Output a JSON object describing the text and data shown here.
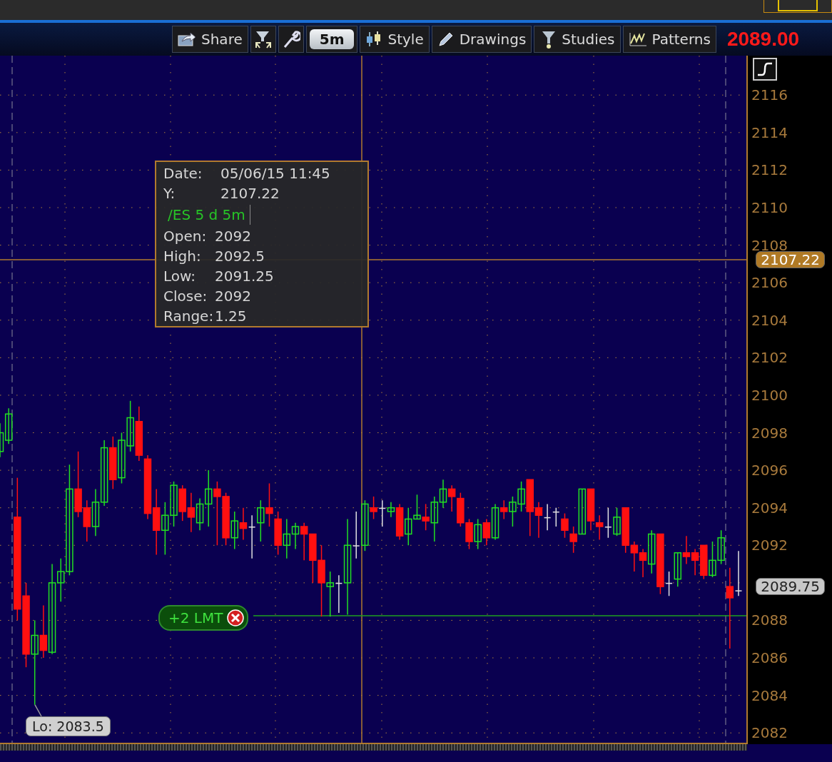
{
  "toolbar": {
    "buttons": [
      {
        "kind": "text",
        "label": "Share"
      },
      {
        "kind": "icon"
      },
      {
        "kind": "icon"
      },
      {
        "kind": "interval",
        "label": "5m",
        "selected": true
      },
      {
        "kind": "text",
        "label": "Style"
      },
      {
        "kind": "text",
        "label": "Drawings"
      },
      {
        "kind": "text",
        "label": "Studies"
      },
      {
        "kind": "text",
        "label": "Patterns"
      }
    ],
    "last_price": "2089.00"
  },
  "chart": {
    "chart_data": {
      "type": "candlestick",
      "ylim": [
        2081.4,
        2118.1
      ],
      "grid": true,
      "ref_lines": [
        {
          "axis": "y",
          "value": 2107.22
        },
        {
          "axis": "y",
          "value": 2088.25
        }
      ],
      "yticks": [
        2116,
        2114,
        2112,
        2110,
        2108,
        2106,
        2104,
        2102,
        2100,
        2098,
        2096,
        2094,
        2092,
        2088,
        2086,
        2084,
        2082
      ],
      "ohlc": [
        [
          2097,
          2098.5,
          2096.7,
          2098
        ],
        [
          2097.6,
          2099.3,
          2097.4,
          2099
        ],
        [
          2093.5,
          2095.6,
          2088,
          2088.6
        ],
        [
          2089.3,
          2090,
          2085.5,
          2086.2
        ],
        [
          2086.2,
          2088,
          2083.5,
          2087.2
        ],
        [
          2087.2,
          2088.8,
          2086,
          2086.4
        ],
        [
          2086.3,
          2091,
          2086.2,
          2090
        ],
        [
          2090,
          2091.3,
          2089,
          2090.6
        ],
        [
          2090.6,
          2096.3,
          2090.4,
          2095
        ],
        [
          2095,
          2097,
          2093.5,
          2093.8
        ],
        [
          2094,
          2094.4,
          2092.2,
          2093
        ],
        [
          2093,
          2095,
          2092.5,
          2094.3
        ],
        [
          2094.3,
          2097.6,
          2094.1,
          2097.2
        ],
        [
          2097.2,
          2097.8,
          2095,
          2095.5
        ],
        [
          2095.6,
          2098,
          2095.3,
          2097.6
        ],
        [
          2097.3,
          2099.7,
          2097,
          2098.8
        ],
        [
          2098.6,
          2099.4,
          2096.5,
          2096.8
        ],
        [
          2096.6,
          2096.8,
          2093.4,
          2093.7
        ],
        [
          2094,
          2095,
          2091.5,
          2092.8
        ],
        [
          2092.8,
          2094.3,
          2091.5,
          2093.6
        ],
        [
          2093.6,
          2095.4,
          2093,
          2095.2
        ],
        [
          2095,
          2095.2,
          2093.3,
          2093.8
        ],
        [
          2094,
          2094.8,
          2092.7,
          2093.5
        ],
        [
          2093.2,
          2094.5,
          2092.8,
          2094.2
        ],
        [
          2094.2,
          2096,
          2093,
          2095
        ],
        [
          2095,
          2095.4,
          2092,
          2094.6
        ],
        [
          2094.6,
          2094.8,
          2092,
          2092.4
        ],
        [
          2092.4,
          2093.8,
          2091.8,
          2093.3
        ],
        [
          2093.2,
          2094,
          2092.3,
          2092.9
        ],
        [
          2093,
          2093.6,
          2091.3,
          2093
        ],
        [
          2093.2,
          2094.4,
          2092.2,
          2094
        ],
        [
          2094,
          2095.3,
          2093,
          2093.7
        ],
        [
          2093.4,
          2093.8,
          2091.5,
          2092
        ],
        [
          2092,
          2093.4,
          2091.3,
          2092.6
        ],
        [
          2092.6,
          2093.2,
          2091.8,
          2093
        ],
        [
          2093,
          2093.2,
          2091.2,
          2092.6
        ],
        [
          2092.6,
          2092.6,
          2090,
          2091.2
        ],
        [
          2091.2,
          2092,
          2088.2,
          2090
        ],
        [
          2089.8,
          2090.6,
          2088.2,
          2090
        ],
        [
          2090,
          2090.4,
          2088.4,
          2090
        ],
        [
          2090,
          2093.4,
          2088.3,
          2092
        ],
        [
          2092,
          2093.8,
          2091.3,
          2092
        ],
        [
          2092,
          2094.4,
          2091.7,
          2094.2
        ],
        [
          2094,
          2094.6,
          2093.4,
          2093.8
        ],
        [
          2094,
          2094.4,
          2093,
          2094
        ],
        [
          2093.8,
          2094.3,
          2093.5,
          2094
        ],
        [
          2094,
          2094.2,
          2092.3,
          2092.5
        ],
        [
          2092.6,
          2094,
          2092,
          2093.4
        ],
        [
          2093.4,
          2094.7,
          2093.4,
          2093.6
        ],
        [
          2093.5,
          2094.2,
          2092.8,
          2093.3
        ],
        [
          2093.2,
          2094.6,
          2092.2,
          2094.3
        ],
        [
          2094.3,
          2095.5,
          2094,
          2095
        ],
        [
          2095,
          2095.2,
          2093.8,
          2094.6
        ],
        [
          2094.5,
          2094.8,
          2093,
          2093.2
        ],
        [
          2093.2,
          2093.4,
          2091.8,
          2092.2
        ],
        [
          2092.2,
          2093.4,
          2091.8,
          2093.1
        ],
        [
          2093.2,
          2093.4,
          2092,
          2092.4
        ],
        [
          2092.4,
          2094.2,
          2092.3,
          2094
        ],
        [
          2094,
          2094.4,
          2093.4,
          2093.8
        ],
        [
          2093.8,
          2094.6,
          2093,
          2094.3
        ],
        [
          2094.2,
          2095.4,
          2093.8,
          2095
        ],
        [
          2095.5,
          2095.5,
          2092.5,
          2093.8
        ],
        [
          2094,
          2094.3,
          2092.4,
          2093.6
        ],
        [
          2093.5,
          2094.2,
          2092.8,
          2093.5
        ],
        [
          2093.8,
          2094,
          2093,
          2093.8
        ],
        [
          2093.4,
          2093.7,
          2092.4,
          2092.8
        ],
        [
          2092.6,
          2093,
          2091.6,
          2092.2
        ],
        [
          2092.6,
          2095,
          2092.6,
          2095
        ],
        [
          2095,
          2095,
          2092.8,
          2093.3
        ],
        [
          2093.2,
          2093.6,
          2092.3,
          2093
        ],
        [
          2093,
          2094,
          2092.4,
          2093
        ],
        [
          2092.6,
          2094,
          2092.5,
          2093.5
        ],
        [
          2094,
          2094,
          2091.6,
          2092
        ],
        [
          2092,
          2092.2,
          2090.6,
          2091.6
        ],
        [
          2091.6,
          2091.8,
          2090.3,
          2091.2
        ],
        [
          2091,
          2092.8,
          2090.5,
          2092.6
        ],
        [
          2092.6,
          2092.6,
          2089.4,
          2089.8
        ],
        [
          2090,
          2090.6,
          2089.3,
          2090
        ],
        [
          2090.2,
          2091.6,
          2089.8,
          2091.6
        ],
        [
          2091.6,
          2092.5,
          2091,
          2091.4
        ],
        [
          2091.6,
          2091.8,
          2090.4,
          2091.2
        ],
        [
          2092,
          2092,
          2090.2,
          2090.4
        ],
        [
          2090.4,
          2092.2,
          2090.3,
          2091.2
        ],
        [
          2091.2,
          2092.8,
          2091,
          2092.4
        ],
        [
          2089.8,
          2090.8,
          2086.5,
          2089.2
        ],
        [
          2089.6,
          2091.7,
          2089.3,
          2089.6
        ]
      ]
    },
    "price_tags": [
      {
        "kind": "crosshair",
        "text": "2107.22"
      },
      {
        "kind": "last",
        "text": "2089.75"
      }
    ],
    "tooltip": {
      "rows": [
        {
          "label": "Date:",
          "value": "05/06/15 11:45"
        },
        {
          "label": "Y:",
          "value": "2107.22"
        }
      ],
      "symbol": "/ES 5 d 5m",
      "details": [
        {
          "label": "Open:",
          "value": "2092"
        },
        {
          "label": "High:",
          "value": "2092.5"
        },
        {
          "label": "Low:",
          "value": "2091.25"
        },
        {
          "label": "Close:",
          "value": "2092"
        },
        {
          "label": "Range:",
          "value": "1.25"
        }
      ]
    },
    "order_tag": "+2 LMT",
    "low_label": "Lo: 2083.5"
  }
}
